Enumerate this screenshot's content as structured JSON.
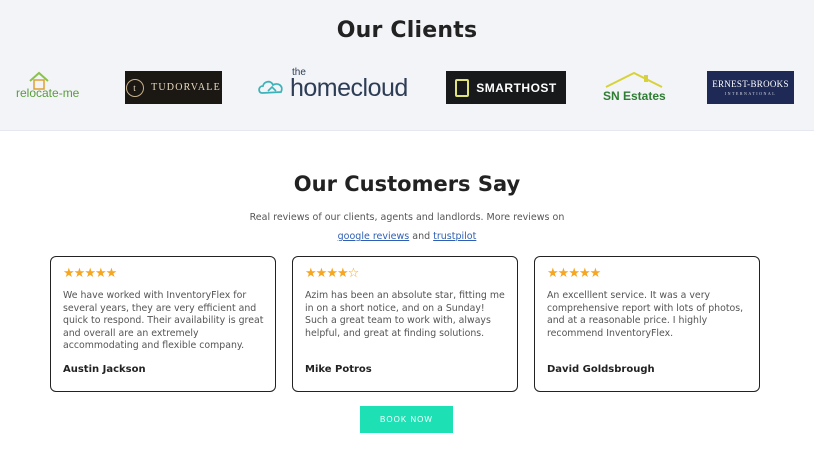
{
  "clients": {
    "title": "Our Clients",
    "logos": {
      "relocate": "relocate-me",
      "tudorvale": "TUDORVALE",
      "tudorvale_mark": "t",
      "homecloud_the": "the",
      "homecloud": "homecloud",
      "smarthost": "SMARTHOST",
      "snestates": "SN Estates",
      "ernest_line1": "ERNEST-BROOKS",
      "ernest_line2": "INTERNATIONAL"
    }
  },
  "testimonials": {
    "title": "Our Customers Say",
    "subtitle_text": "Real reviews of our clients, agents and landlords. More reviews on",
    "link_google": "google reviews",
    "and_text": "and",
    "link_trustpilot": "trustpilot",
    "cards": [
      {
        "rating": 5,
        "text": "We have worked with InventoryFlex for several years, they are very efficient and quick to respond. Their availability is great and overall are an extremely accommodating and flexible company.",
        "author": "Austin Jackson"
      },
      {
        "rating": 4,
        "text": "Azim has been an absolute star, fitting me in on a short notice, and on a Sunday! Such a great team to work with, always helpful, and great at finding solutions.",
        "author": "Mike Potros"
      },
      {
        "rating": 5,
        "text": "An excelllent service. It was a very comprehensive report with lots of photos, and at a reasonable price. I highly recommend InventoryFlex.",
        "author": "David Goldsbrough"
      }
    ]
  },
  "cta": {
    "book_label": "BOOK NOW"
  },
  "colors": {
    "star": "#f5a623",
    "cta": "#1de1b4",
    "link": "#2f5fb3"
  }
}
